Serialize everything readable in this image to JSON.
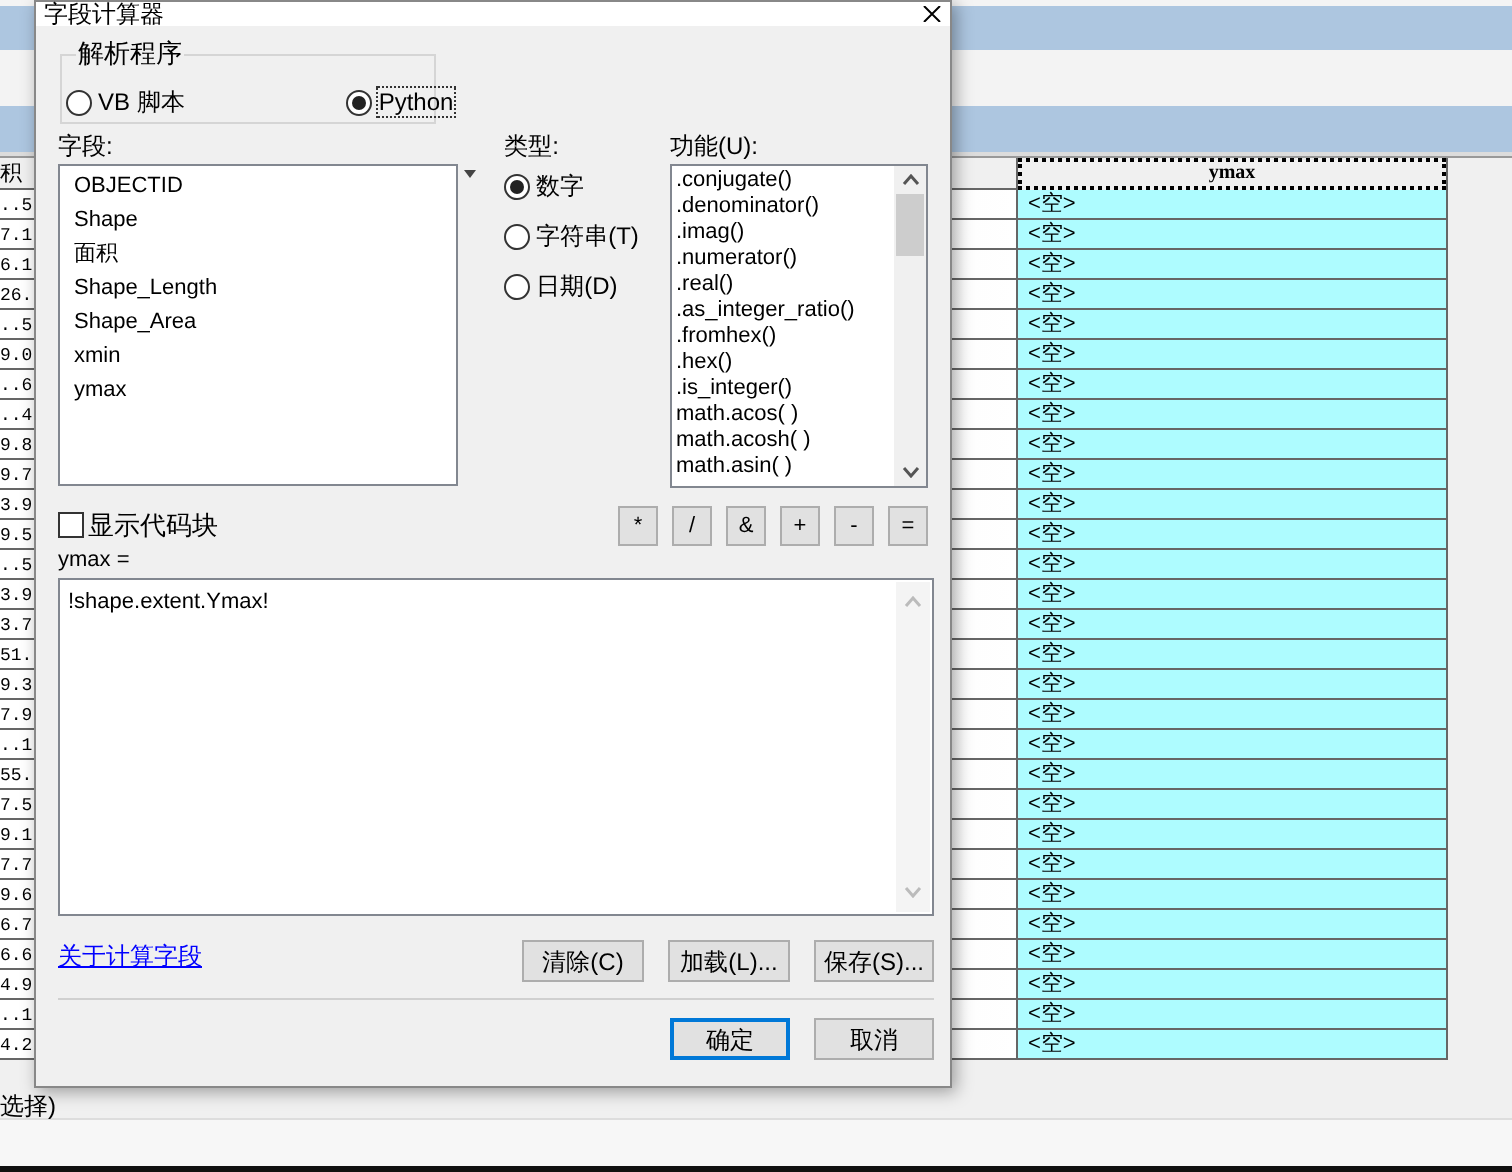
{
  "dialog": {
    "title": "字段计算器",
    "parser": {
      "label": "解析程序",
      "options": [
        {
          "label": "VB 脚本",
          "selected": false
        },
        {
          "label": "Python",
          "selected": true
        }
      ]
    },
    "fields": {
      "label": "字段:",
      "items": [
        "OBJECTID",
        "Shape",
        "面积",
        "Shape_Length",
        "Shape_Area",
        "xmin",
        "ymax"
      ]
    },
    "type": {
      "label": "类型:",
      "options": [
        {
          "label": "数字",
          "selected": true
        },
        {
          "label": "字符串(T)",
          "selected": false
        },
        {
          "label": "日期(D)",
          "selected": false
        }
      ]
    },
    "functions": {
      "label": "功能(U):",
      "items": [
        ".conjugate()",
        ".denominator()",
        ".imag()",
        ".numerator()",
        ".real()",
        ".as_integer_ratio()",
        ".fromhex()",
        ".hex()",
        ".is_integer()",
        "math.acos( )",
        "math.acosh( )",
        "math.asin( )"
      ]
    },
    "show_code_block": {
      "label": "显示代码块",
      "checked": false
    },
    "operators": [
      "*",
      "/",
      "&",
      "+",
      "-",
      "="
    ],
    "expression": {
      "label": "ymax =",
      "value": "!shape.extent.Ymax!"
    },
    "help_link": "关于计算字段",
    "buttons": [
      "清除(C)",
      "加载(L)...",
      "保存(S)..."
    ],
    "footer_buttons": [
      {
        "label": "确定",
        "default": true
      },
      {
        "label": "取消",
        "default": false
      }
    ]
  },
  "table": {
    "header_fragment": "积",
    "column_header": "ymax",
    "rows": [
      {
        "fragment": "..5",
        "ymax": "<空>"
      },
      {
        "fragment": "7.1",
        "ymax": "<空>"
      },
      {
        "fragment": "6.1",
        "ymax": "<空>"
      },
      {
        "fragment": "26.",
        "ymax": "<空>"
      },
      {
        "fragment": "..5",
        "ymax": "<空>"
      },
      {
        "fragment": "9.0",
        "ymax": "<空>"
      },
      {
        "fragment": "..6",
        "ymax": "<空>"
      },
      {
        "fragment": "..4",
        "ymax": "<空>"
      },
      {
        "fragment": "9.8",
        "ymax": "<空>"
      },
      {
        "fragment": "9.7",
        "ymax": "<空>"
      },
      {
        "fragment": "3.9",
        "ymax": "<空>"
      },
      {
        "fragment": "9.5",
        "ymax": "<空>"
      },
      {
        "fragment": "..5",
        "ymax": "<空>"
      },
      {
        "fragment": "3.9",
        "ymax": "<空>"
      },
      {
        "fragment": "3.7",
        "ymax": "<空>"
      },
      {
        "fragment": "51.",
        "ymax": "<空>"
      },
      {
        "fragment": "9.3",
        "ymax": "<空>"
      },
      {
        "fragment": "7.9",
        "ymax": "<空>"
      },
      {
        "fragment": "..1",
        "ymax": "<空>"
      },
      {
        "fragment": "55.",
        "ymax": "<空>"
      },
      {
        "fragment": "7.5",
        "ymax": "<空>"
      },
      {
        "fragment": "9.1",
        "ymax": "<空>"
      },
      {
        "fragment": "7.7",
        "ymax": "<空>"
      },
      {
        "fragment": "9.6",
        "ymax": "<空>"
      },
      {
        "fragment": "6.7",
        "ymax": "<空>"
      },
      {
        "fragment": "6.6",
        "ymax": "<空>"
      },
      {
        "fragment": "4.9",
        "ymax": "<空>"
      },
      {
        "fragment": "..1",
        "ymax": "<空>"
      },
      {
        "fragment": "4.2",
        "ymax": "<空>"
      }
    ]
  },
  "status_fragment": "选择)"
}
